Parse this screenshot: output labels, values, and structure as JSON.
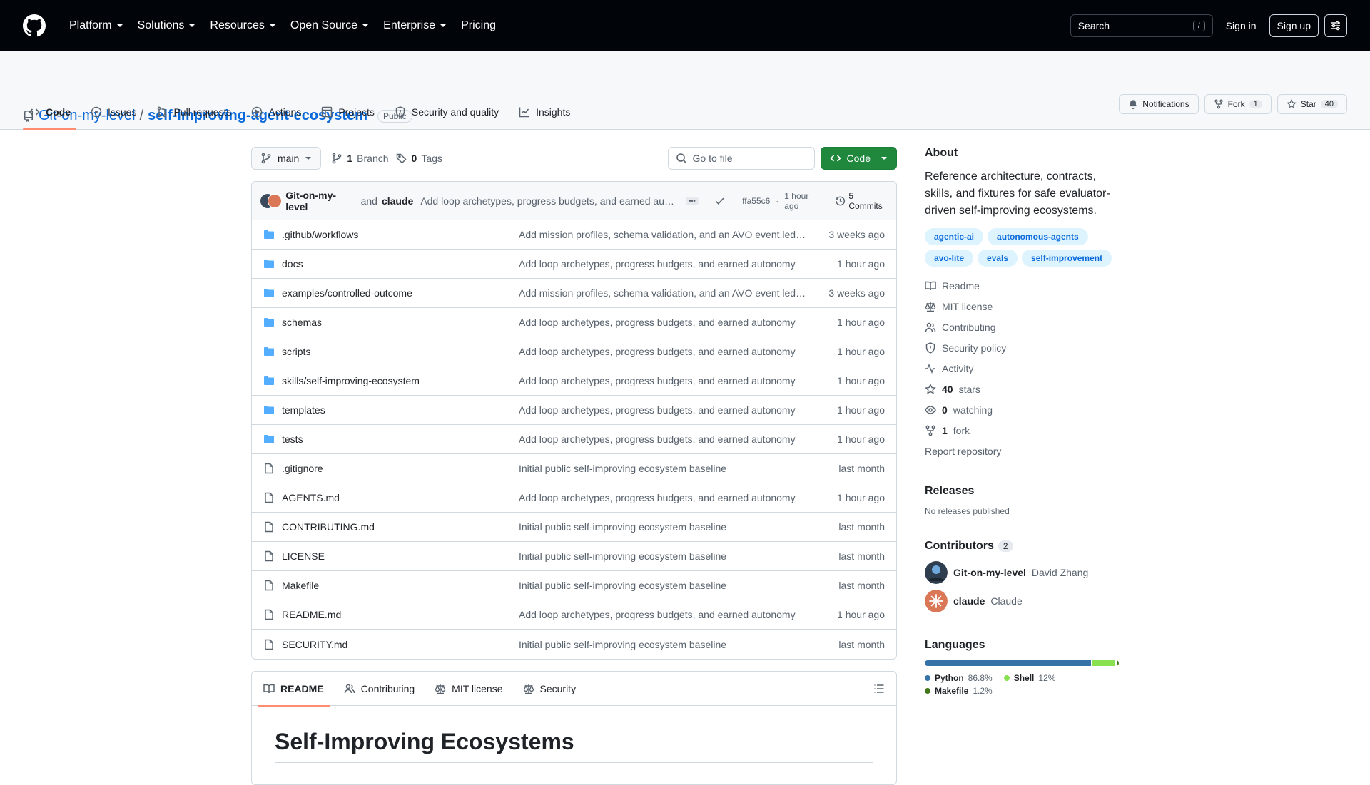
{
  "header": {
    "nav": [
      "Platform",
      "Solutions",
      "Resources",
      "Open Source",
      "Enterprise",
      "Pricing"
    ],
    "search_label": "Search",
    "search_kbd": "/",
    "sign_in": "Sign in",
    "sign_up": "Sign up"
  },
  "repo": {
    "owner": "Git-on-my-level",
    "separator": "/",
    "name": "self-improving-agent-ecosystem",
    "visibility": "Public",
    "notifications": "Notifications",
    "fork_label": "Fork",
    "fork_count": "1",
    "star_label": "Star",
    "star_count": "40"
  },
  "tabs": [
    "Code",
    "Issues",
    "Pull requests",
    "Actions",
    "Projects",
    "Security and quality",
    "Insights"
  ],
  "branchbar": {
    "branch": "main",
    "branches_count": "1",
    "branches_label": "Branch",
    "tags_count": "0",
    "tags_label": "Tags",
    "goto_placeholder": "Go to file",
    "code_button": "Code"
  },
  "commit": {
    "author1": "Git-on-my-level",
    "and": "and",
    "author2": "claude",
    "message": "Add loop archetypes, progress budgets, and earned autonomy",
    "sha": "ffa55c6",
    "time": "1 hour ago",
    "commits_label": "5 Commits"
  },
  "files": [
    {
      "type": "dir",
      "name": ".github/workflows",
      "msg": "Add mission profiles, schema validation, and an AVO event ledger",
      "time": "3 weeks ago"
    },
    {
      "type": "dir",
      "name": "docs",
      "msg": "Add loop archetypes, progress budgets, and earned autonomy",
      "time": "1 hour ago"
    },
    {
      "type": "dir",
      "name": "examples/controlled-outcome",
      "msg": "Add mission profiles, schema validation, and an AVO event ledger",
      "time": "3 weeks ago"
    },
    {
      "type": "dir",
      "name": "schemas",
      "msg": "Add loop archetypes, progress budgets, and earned autonomy",
      "time": "1 hour ago"
    },
    {
      "type": "dir",
      "name": "scripts",
      "msg": "Add loop archetypes, progress budgets, and earned autonomy",
      "time": "1 hour ago"
    },
    {
      "type": "dir",
      "name": "skills/self-improving-ecosystem",
      "msg": "Add loop archetypes, progress budgets, and earned autonomy",
      "time": "1 hour ago"
    },
    {
      "type": "dir",
      "name": "templates",
      "msg": "Add loop archetypes, progress budgets, and earned autonomy",
      "time": "1 hour ago"
    },
    {
      "type": "dir",
      "name": "tests",
      "msg": "Add loop archetypes, progress budgets, and earned autonomy",
      "time": "1 hour ago"
    },
    {
      "type": "file",
      "name": ".gitignore",
      "msg": "Initial public self-improving ecosystem baseline",
      "time": "last month"
    },
    {
      "type": "file",
      "name": "AGENTS.md",
      "msg": "Add loop archetypes, progress budgets, and earned autonomy",
      "time": "1 hour ago"
    },
    {
      "type": "file",
      "name": "CONTRIBUTING.md",
      "msg": "Initial public self-improving ecosystem baseline",
      "time": "last month"
    },
    {
      "type": "file",
      "name": "LICENSE",
      "msg": "Initial public self-improving ecosystem baseline",
      "time": "last month"
    },
    {
      "type": "file",
      "name": "Makefile",
      "msg": "Initial public self-improving ecosystem baseline",
      "time": "last month"
    },
    {
      "type": "file",
      "name": "README.md",
      "msg": "Add loop archetypes, progress budgets, and earned autonomy",
      "time": "1 hour ago"
    },
    {
      "type": "file",
      "name": "SECURITY.md",
      "msg": "Initial public self-improving ecosystem baseline",
      "time": "last month"
    }
  ],
  "readme": {
    "tabs": [
      "README",
      "Contributing",
      "MIT license",
      "Security"
    ],
    "title": "Self-Improving Ecosystems"
  },
  "about": {
    "heading": "About",
    "description": "Reference architecture, contracts, skills, and fixtures for safe evaluator-driven self-improving ecosystems.",
    "topics": [
      "agentic-ai",
      "autonomous-agents",
      "avo-lite",
      "evals",
      "self-improvement"
    ],
    "links": {
      "readme": "Readme",
      "license": "MIT license",
      "contributing": "Contributing",
      "security": "Security policy",
      "activity": "Activity",
      "stars_count": "40",
      "stars_label": "stars",
      "watching_count": "0",
      "watching_label": "watching",
      "fork_count": "1",
      "fork_label": "fork",
      "report": "Report repository"
    }
  },
  "releases": {
    "heading": "Releases",
    "empty": "No releases published"
  },
  "contributors": {
    "heading": "Contributors",
    "count": "2",
    "list": [
      {
        "login": "Git-on-my-level",
        "name": "David Zhang"
      },
      {
        "login": "claude",
        "name": "Claude"
      }
    ]
  },
  "languages": {
    "heading": "Languages",
    "list": [
      {
        "name": "Python",
        "pct": "86.8%",
        "value": 86.8,
        "color": "#3572A5"
      },
      {
        "name": "Shell",
        "pct": "12%",
        "value": 12,
        "color": "#89e051"
      },
      {
        "name": "Makefile",
        "pct": "1.2%",
        "value": 1.2,
        "color": "#427819"
      }
    ]
  }
}
